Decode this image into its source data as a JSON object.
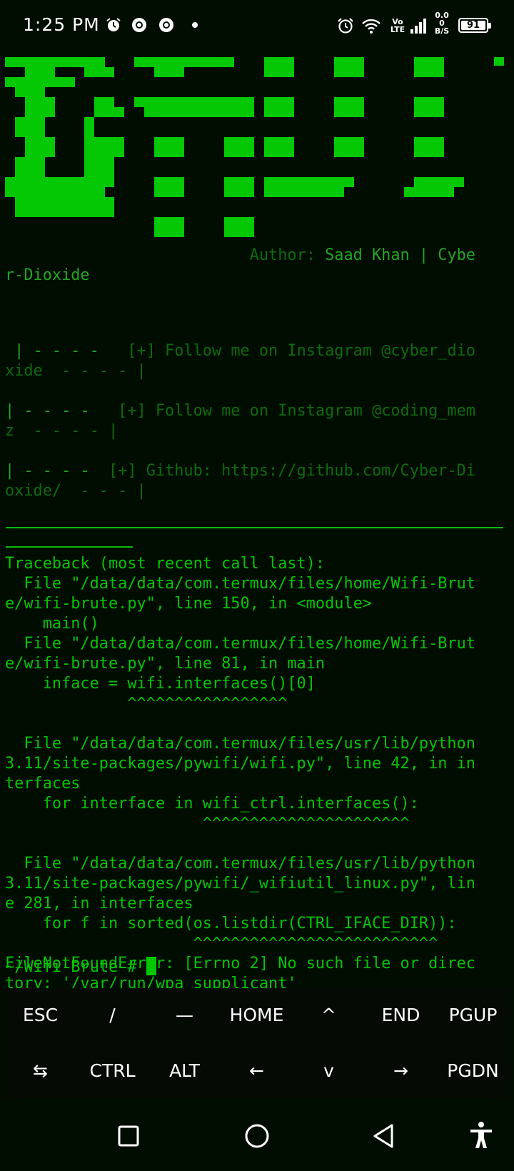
{
  "status_bar": {
    "time": "1:25 PM",
    "net_top": "0.0",
    "net_mid": "0",
    "net_unit": "B/S",
    "volte_top": "Vo",
    "volte_bottom": "LTE",
    "battery": "91",
    "icons": [
      "alarm-icon",
      "chrome-icon",
      "chrome-icon",
      "dot-icon",
      "alarm-icon",
      "wifi-icon",
      "volte-icon",
      "signal-icon",
      "battery-icon"
    ]
  },
  "terminal": {
    "author_label": "Author: ",
    "author_name": "Saad Khan | Cybe",
    "author_name2": "r-Dioxide",
    "follow1_prefix": " | - - - -   ",
    "follow1_text": "[+] Follow me on Instagram @cyber_dio",
    "follow1_line2": "xide  - - - - |",
    "follow2_prefix": "| - - - -   ",
    "follow2_text": "[+] Follow me on Instagram @coding_mem",
    "follow2_line2": "z  - - - - |",
    "github_prefix": "| - - - -  ",
    "github_text": "[+] Github: https://github.com/Cyber-Di",
    "github_line2": "oxide/  - - - |",
    "traceback": [
      "Traceback (most recent call last):",
      "  File \"/data/data/com.termux/files/home/Wifi-Brut",
      "e/wifi-brute.py\", line 150, in <module>",
      "    main()",
      "  File \"/data/data/com.termux/files/home/Wifi-Brut",
      "e/wifi-brute.py\", line 81, in main",
      "    inface = wifi.interfaces()[0]",
      "             ^^^^^^^^^^^^^^^^^",
      "",
      "  File \"/data/data/com.termux/files/usr/lib/python",
      "3.11/site-packages/pywifi/wifi.py\", line 42, in in",
      "terfaces",
      "    for interface in wifi_ctrl.interfaces():",
      "                     ^^^^^^^^^^^^^^^^^^^^^^",
      "",
      "  File \"/data/data/com.termux/files/usr/lib/python",
      "3.11/site-packages/pywifi/_wifiutil_linux.py\", lin",
      "e 281, in interfaces",
      "    for f in sorted(os.listdir(CTRL_IFACE_DIR)):",
      "                    ^^^^^^^^^^^^^^^^^^^^^^^^^^",
      "FileNotFoundError: [Errno 2] No such file or direc",
      "tory: '/var/run/wpa_supplicant'"
    ],
    "prompt": "~/Wifi-Brute # "
  },
  "extra_keys": {
    "row1": [
      "ESC",
      "/",
      "—",
      "HOME",
      "^",
      "END",
      "PGUP"
    ],
    "row2": [
      "⇆",
      "CTRL",
      "ALT",
      "←",
      "v",
      "→",
      "PGDN"
    ]
  },
  "nav_bar": {
    "icons": [
      "recents-icon",
      "home-icon",
      "back-icon",
      "accessibility-icon"
    ]
  },
  "colors": {
    "terminal_bg": "#010d01",
    "green_text": "#07c207",
    "dim_green": "#0f6a0f",
    "banner_green": "#03c803"
  }
}
